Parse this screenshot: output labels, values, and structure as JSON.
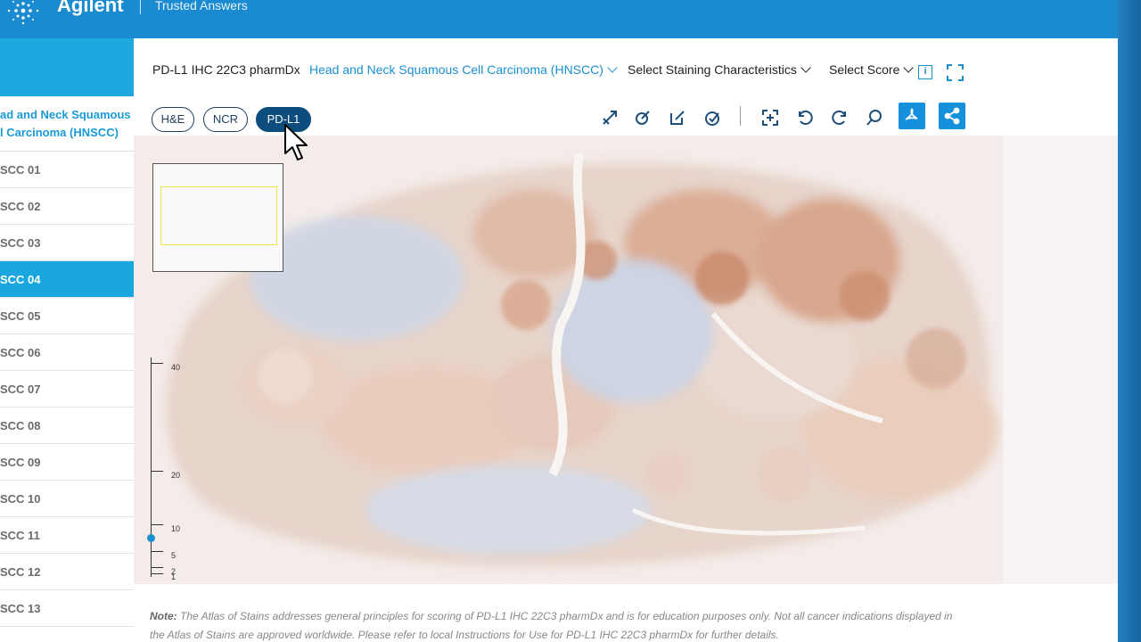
{
  "brand": {
    "name": "Agilent",
    "tagline": "Trusted Answers"
  },
  "sidebar": {
    "category": [
      "ad and Neck Squamous",
      "l Carcinoma (HNSCC)"
    ],
    "items": [
      "SCC 01",
      "SCC 02",
      "SCC 03",
      "SCC 04",
      "SCC 05",
      "SCC 06",
      "SCC 07",
      "SCC 08",
      "SCC 09",
      "SCC 10",
      "SCC 11",
      "SCC 12",
      "SCC 13"
    ],
    "active_index": 3
  },
  "header": {
    "assay": "PD-L1 IHC 22C3 pharmDx",
    "indication": "Head and Neck Squamous Cell Carcinoma (HNSCC)",
    "staining": "Select Staining Characteristics",
    "score": "Select Score",
    "info_label": "i"
  },
  "stains": [
    "H&E",
    "NCR",
    "PD-L1"
  ],
  "active_stain": "PD-L1",
  "toolbar": {
    "icons": [
      "draw-line-icon",
      "edit-circle-icon",
      "edit-square-icon",
      "edit-check-icon",
      "fit-screen-icon",
      "rotate-left-icon",
      "rotate-right-icon",
      "search-zoom-icon",
      "pdf-icon",
      "share-icon"
    ]
  },
  "zoom_scale": {
    "labels": [
      "40",
      "20",
      "10",
      "5",
      "2",
      "1"
    ],
    "current": 10
  },
  "note": {
    "label": "Note:",
    "text": "The Atlas of Stains addresses general principles for scoring of PD-L1 IHC 22C3 pharmDx and is for education purposes only. Not all cancer indications displayed in the Atlas of Stains are approved worldwide. Please refer to local Instructions for Use for PD-L1 IHC 22C3 pharmDx for further details."
  },
  "colors": {
    "accent": "#1a8fd0",
    "sidebar_active": "#1aa6df",
    "pill_active": "#0d4d7d",
    "banner": "#1a8bd1"
  }
}
